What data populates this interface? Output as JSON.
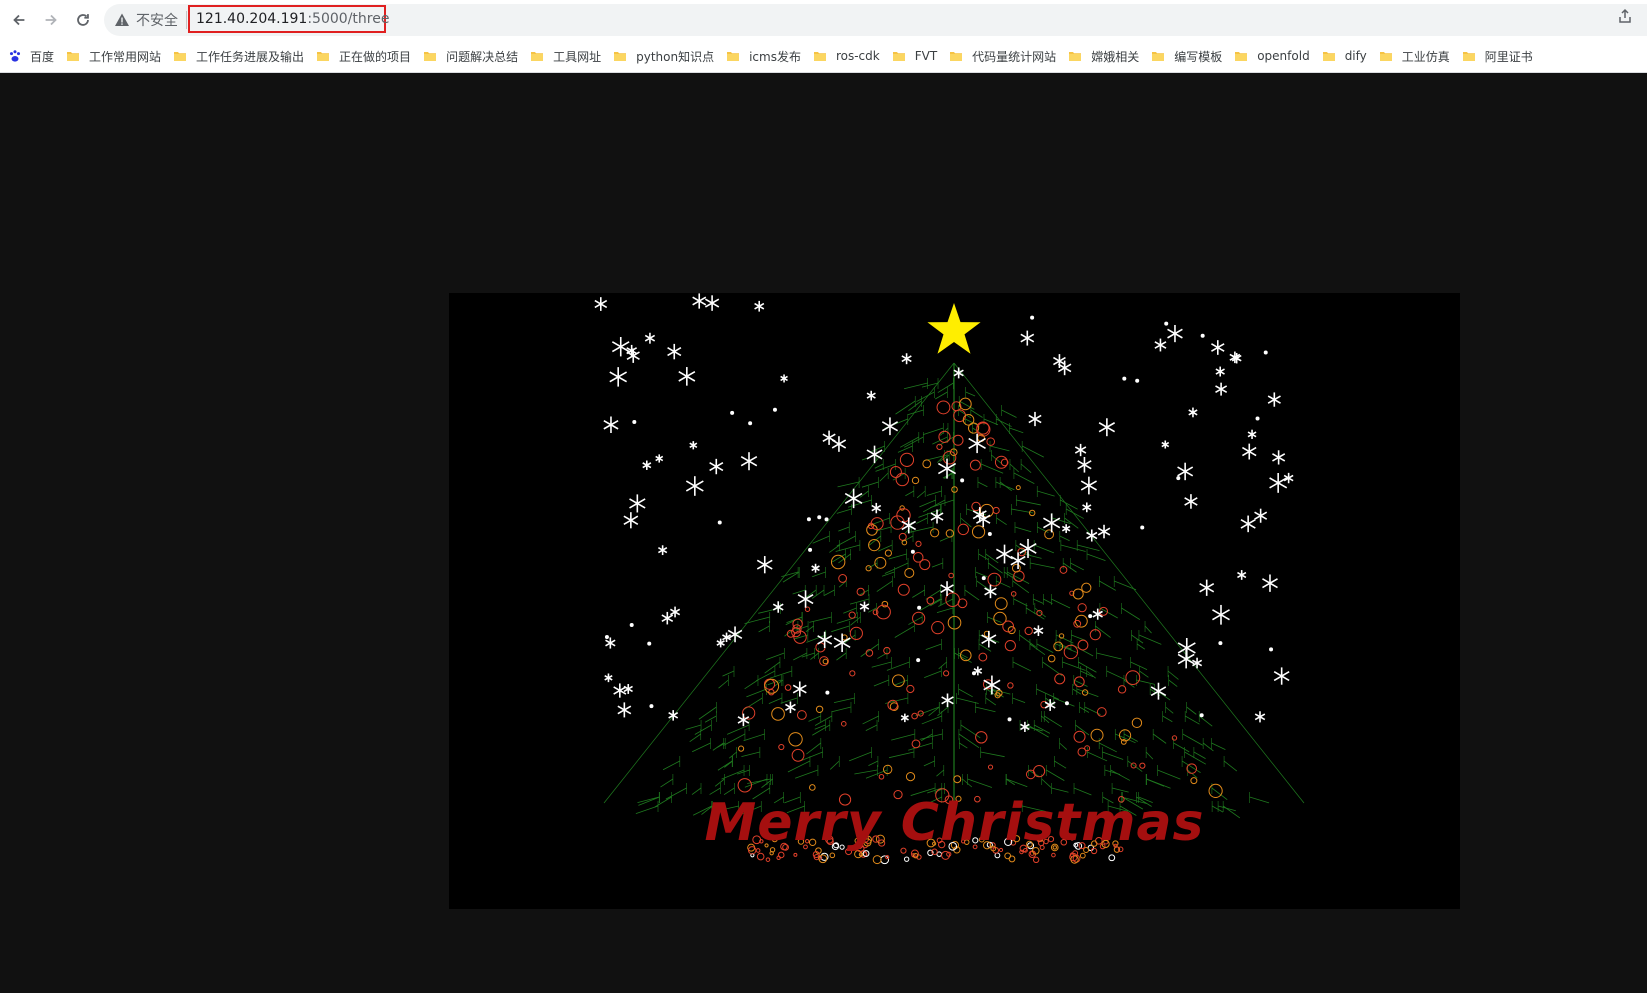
{
  "browser": {
    "security_label": "不安全",
    "url_host": "121.40.204.191",
    "url_path": ":5000/three"
  },
  "bookmarks": [
    {
      "label": "百度",
      "icon": "baidu-paw-icon"
    },
    {
      "label": "工作常用网站",
      "icon": "folder-icon"
    },
    {
      "label": "工作任务进展及输出",
      "icon": "folder-icon"
    },
    {
      "label": "正在做的项目",
      "icon": "folder-icon"
    },
    {
      "label": "问题解决总结",
      "icon": "folder-icon"
    },
    {
      "label": "工具网址",
      "icon": "folder-icon"
    },
    {
      "label": "python知识点",
      "icon": "folder-icon"
    },
    {
      "label": "icms发布",
      "icon": "folder-icon"
    },
    {
      "label": "ros-cdk",
      "icon": "folder-icon"
    },
    {
      "label": "FVT",
      "icon": "folder-icon"
    },
    {
      "label": "代码量统计网站",
      "icon": "folder-icon"
    },
    {
      "label": "嫦娥相关",
      "icon": "folder-icon"
    },
    {
      "label": "编写模板",
      "icon": "folder-icon"
    },
    {
      "label": "openfold",
      "icon": "folder-icon"
    },
    {
      "label": "dify",
      "icon": "folder-icon"
    },
    {
      "label": "工业仿真",
      "icon": "folder-icon"
    },
    {
      "label": "阿里证书",
      "icon": "folder-icon"
    }
  ],
  "scene": {
    "greeting": "Merry Christmas",
    "colors": {
      "star": "#ffee00",
      "tree": "#1f7a1f",
      "ornament_red": "#e0402a",
      "ornament_orange": "#e08a1a",
      "snow": "#ffffff",
      "greeting": "#a50f0f"
    }
  }
}
